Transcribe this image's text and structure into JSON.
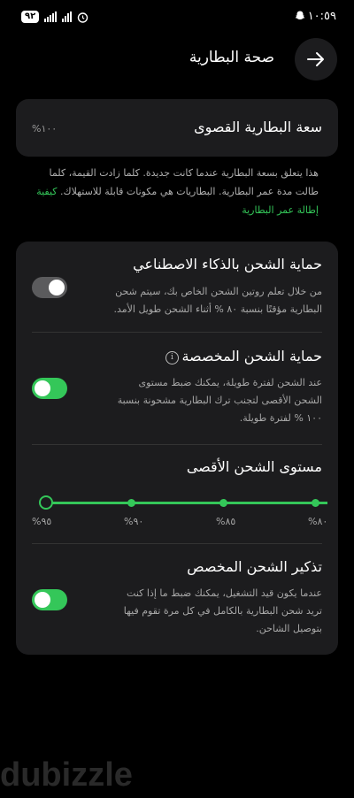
{
  "status_bar": {
    "time": "١٠:٥٩",
    "battery": "٩٢",
    "snapchat_icon": "ghost-icon",
    "alarm_icon": "alarm-icon"
  },
  "header": {
    "title": "صحة البطارية",
    "back_icon": "arrow-right-icon"
  },
  "max_capacity": {
    "title": "سعة البطارية القصوى",
    "value": "%١٠٠"
  },
  "description": {
    "text": "هذا يتعلق بسعة البطارية عندما كانت جديدة. كلما زادت القيمة، كلما طالت مدة عمر البطارية. البطاريات هي مكونات قابلة للاستهلاك.",
    "link": "كيفية إطالة عمر البطارية"
  },
  "ai_protection": {
    "title": "حماية الشحن بالذكاء الاصطناعي",
    "desc": "من خلال تعلم روتين الشحن الخاص بك، سيتم شحن البطارية مؤقتًا بنسبة ٨٠ % أثناء الشحن طويل الأمد.",
    "enabled": false
  },
  "custom_protection": {
    "title": "حماية الشحن المخصصة",
    "desc": "عند الشحن لفترة طويلة، يمكنك ضبط مستوى الشحن الأقصى لتجنب ترك البطارية مشحونة بنسبة ١٠٠ % لفترة طويلة.",
    "enabled": true
  },
  "max_level": {
    "title": "مستوى الشحن الأقصى",
    "ticks": [
      "%٩٥",
      "%٩٠",
      "%٨٥",
      "%٨٠"
    ],
    "selected": "%٩٥"
  },
  "reminder": {
    "title": "تذكير الشحن المخصص",
    "desc": "عندما يكون قيد التشغيل، يمكنك ضبط ما إذا كنت تريد شحن البطارية بالكامل في كل مرة تقوم فيها بتوصيل الشاحن.",
    "enabled": true
  },
  "colors": {
    "accent": "#34c759",
    "card": "#1c1c1e",
    "background": "#000000"
  },
  "watermark": "dubizzle"
}
